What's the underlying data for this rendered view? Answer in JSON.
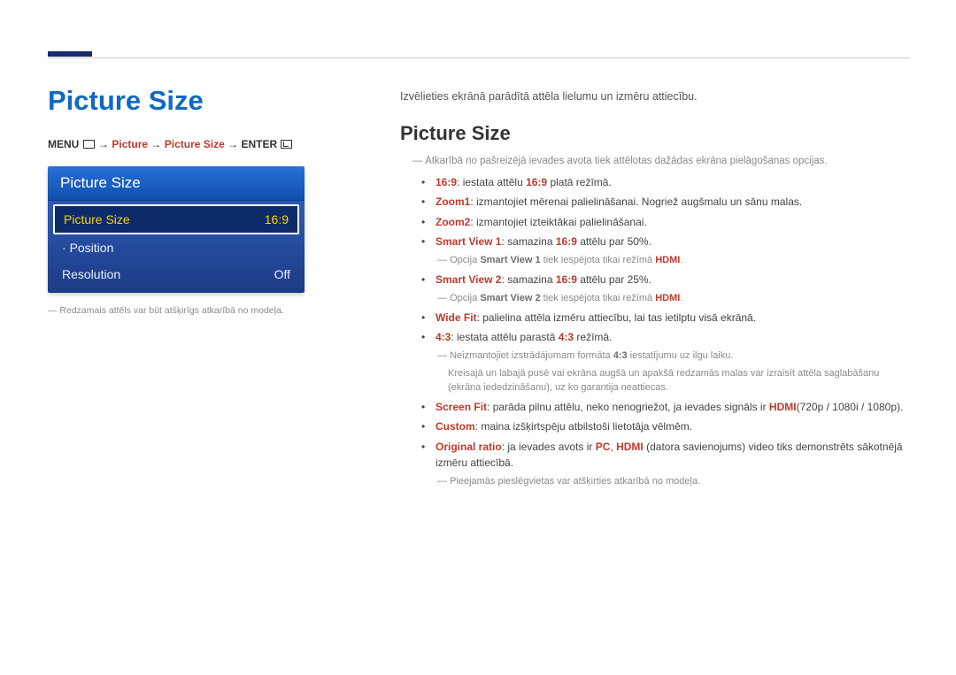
{
  "left": {
    "title": "Picture Size",
    "menupath": {
      "menu": "MENU",
      "arrow1": " → ",
      "picture": "Picture",
      "arrow2": " → ",
      "picture_size": "Picture Size",
      "arrow3": " → ",
      "enter": "ENTER"
    },
    "osd": {
      "header": "Picture Size",
      "row_selected_label": "Picture Size",
      "row_selected_value": "16:9",
      "row_position": "Position",
      "row_resolution_label": "Resolution",
      "row_resolution_value": "Off"
    },
    "footnote": "Redzamais attēls var būt atšķirīgs atkarībā no modeļa."
  },
  "right": {
    "intro": "Izvēlieties ekrānā parādītā attēla lielumu un izmēru attiecību.",
    "subheading": "Picture Size",
    "note_top": "Atkarībā no pašreizējā ievades avota tiek attēlotas dažādas ekrāna pielāgošanas opcijas.",
    "items": {
      "i1": {
        "label": "16:9",
        "text": ": iestata attēlu ",
        "hl2": "16:9",
        "tail": " platā režīmā."
      },
      "i2": {
        "label": "Zoom1",
        "text": ": izmantojiet mērenai palielināšanai. Nogriež augšmalu un sānu malas."
      },
      "i3": {
        "label": "Zoom2",
        "text": ": izmantojiet izteiktākai palielināšanai."
      },
      "i4": {
        "label": "Smart View 1",
        "text": ": samazina ",
        "hl2": "16:9",
        "tail": " attēlu par 50%."
      },
      "i4_note_a": "Opcija ",
      "i4_note_b": "Smart View 1",
      "i4_note_c": " tiek iespējota tikai režīmā ",
      "i4_note_d": "HDMI",
      "i4_note_e": ".",
      "i5": {
        "label": "Smart View 2",
        "text": ": samazina ",
        "hl2": "16:9",
        "tail": " attēlu par 25%."
      },
      "i5_note_a": "Opcija ",
      "i5_note_b": "Smart View 2",
      "i5_note_c": " tiek iespējota tikai režīmā ",
      "i5_note_d": "HDMI",
      "i5_note_e": ".",
      "i6": {
        "label": "Wide Fit",
        "text": ": palielina attēla izmēru attiecību, lai tas ietilptu visā ekrānā."
      },
      "i7": {
        "label": "4:3",
        "text": ": iestata attēlu parastā ",
        "hl2": "4:3",
        "tail": " režīmā."
      },
      "i7_note1_a": "Neizmantojiet izstrādājumam formāta ",
      "i7_note1_b": "4:3",
      "i7_note1_c": " iestatījumu uz ilgu laiku.",
      "i7_note2": "Kreisajā un labajā pusē vai ekrāna augšā un apakšā redzamās malas var izraisīt attēla saglabāšanu (ekrāna iededzināšanu), uz ko garantija neattiecas.",
      "i8": {
        "label": "Screen Fit",
        "text": ": parāda pilnu attēlu, neko nenogriežot, ja ievades signāls ir ",
        "hl2": "HDMI",
        "tail": "(720p / 1080i / 1080p)."
      },
      "i9": {
        "label": "Custom",
        "text": ": maina izšķirtspēju atbilstoši lietotāja vēlmēm."
      },
      "i10_a": "Original ratio",
      "i10_b": ": ja ievades avots ir ",
      "i10_c": "PC",
      "i10_d": ", ",
      "i10_e": "HDMI",
      "i10_f": " (datora savienojums) video tiks demonstrēts sākotnējā izmēru attiecībā.",
      "bottom_note": "Pieejamās pieslēgvietas var atšķirties atkarībā no modeļa."
    }
  }
}
